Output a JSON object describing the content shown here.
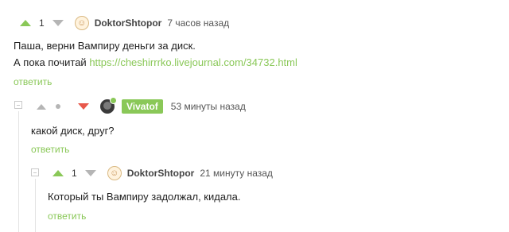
{
  "comments": [
    {
      "score": "1",
      "author": "DoktorShtopor",
      "time": "7 часов назад",
      "text_line1": "Паша, верни Вампиру деньги за диск.",
      "text_line2_prefix": "А пока почитай ",
      "link": "https://cheshirrrko.livejournal.com/34732.html",
      "reply": "ответить"
    },
    {
      "author": "Vivatof",
      "time": "53 минуты назад",
      "text": "какой диск, друг?",
      "reply": "ответить"
    },
    {
      "score": "1",
      "author": "DoktorShtopor",
      "time": "21 минуту назад",
      "text": "Который ты Вампиру задолжал, кидала.",
      "reply": "ответить"
    }
  ],
  "colors": {
    "accent_green": "#8ac858",
    "downvote_red": "#e8584b",
    "neutral_gray": "#b5b5b5"
  }
}
